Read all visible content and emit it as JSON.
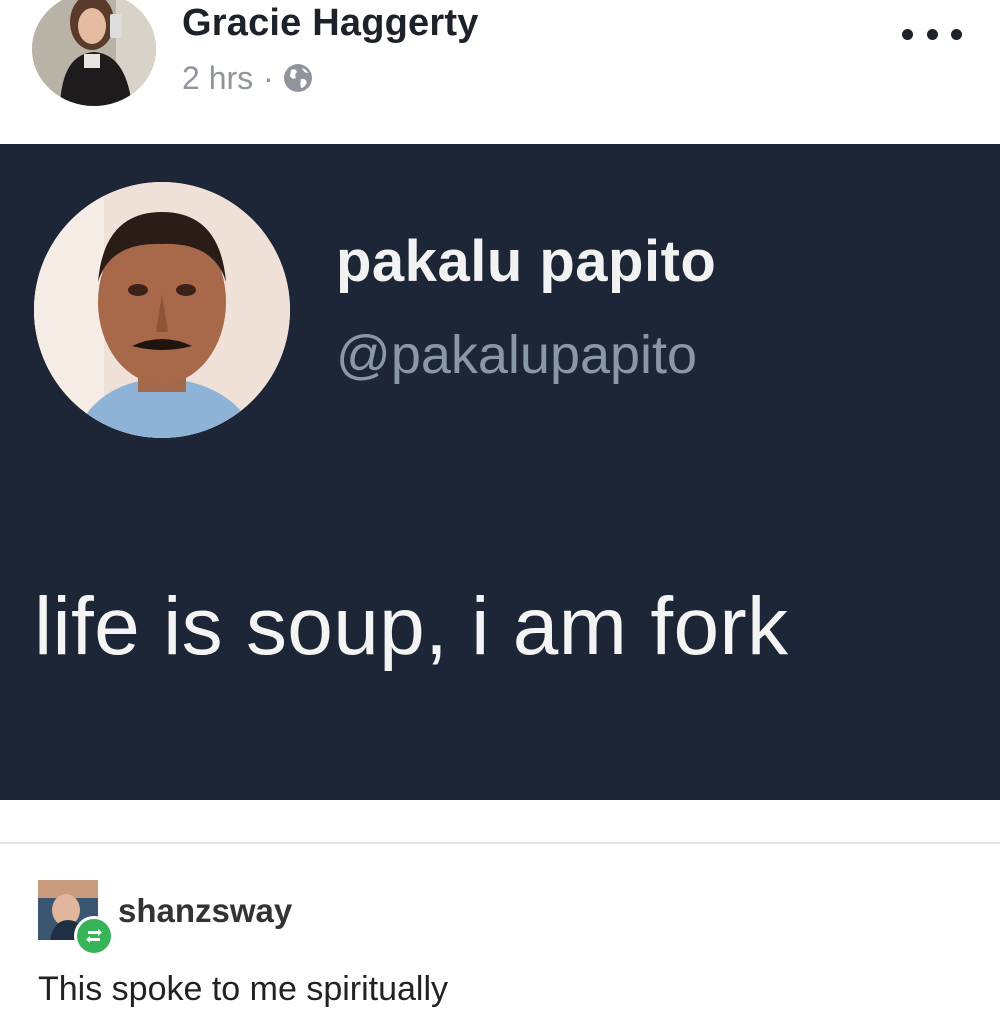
{
  "post": {
    "author": "Gracie Haggerty",
    "timestamp": "2 hrs",
    "separator": "·",
    "privacy_icon": "globe-icon",
    "more_icon": "more-options-icon"
  },
  "tweet": {
    "display_name": "pakalu papito",
    "handle": "@pakalupapito",
    "text": "life is soup, i am fork",
    "background": "#1c2636"
  },
  "reblog": {
    "username": "shanzsway",
    "comment": "This spoke to me spiritually",
    "badge_icon": "reblog-icon",
    "badge_color": "#38b458"
  }
}
